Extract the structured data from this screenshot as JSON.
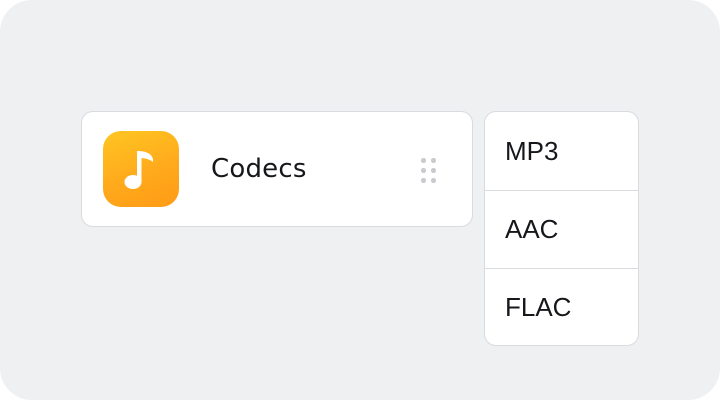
{
  "item": {
    "label": "Codecs",
    "icon": "music-note-icon",
    "icon_color": "#ffb01e"
  },
  "drag_handle": {
    "icon": "drag-handle-icon"
  },
  "dropdown": {
    "options": [
      "MP3",
      "AAC",
      "FLAC"
    ]
  }
}
